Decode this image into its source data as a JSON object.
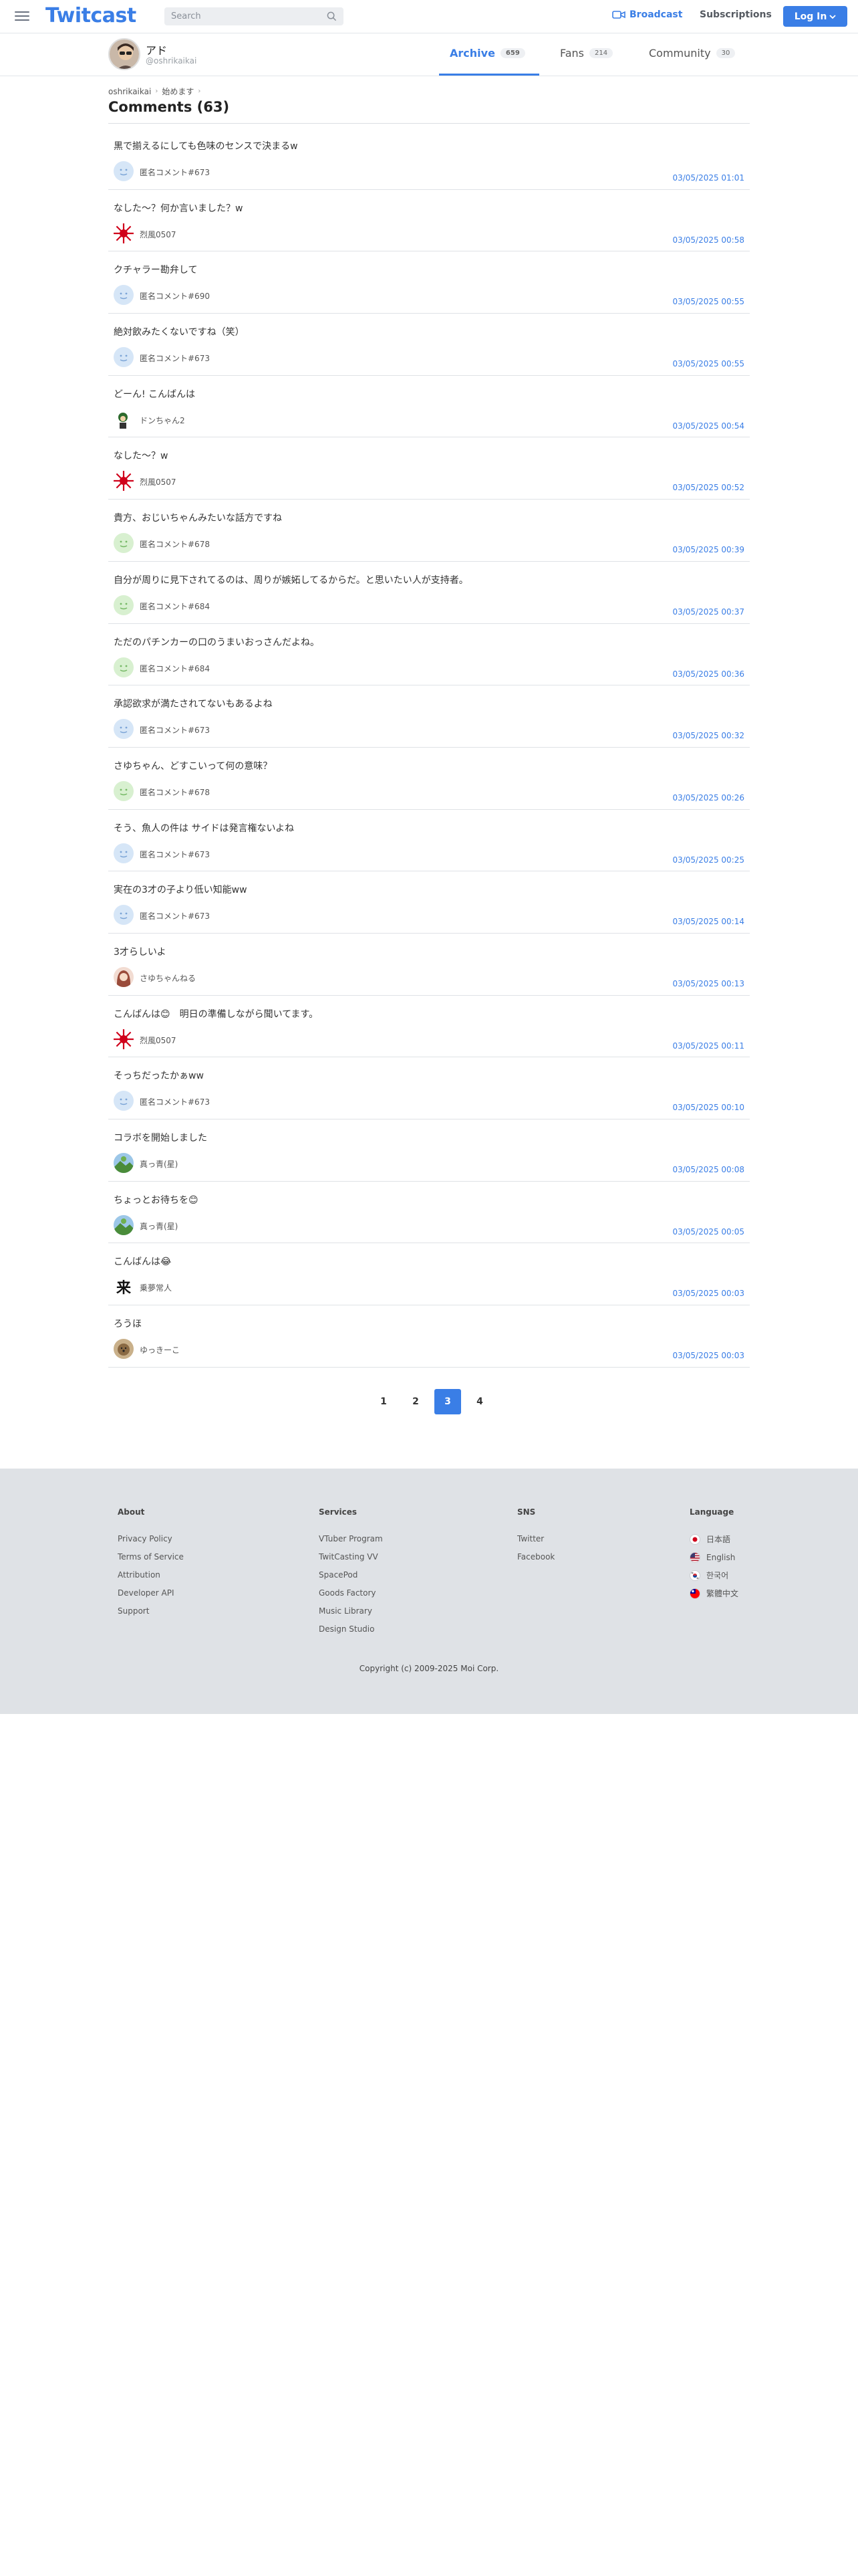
{
  "header": {
    "logo": "Twitcast",
    "search_placeholder": "Search",
    "broadcast_label": "Broadcast",
    "subscriptions_label": "Subscriptions",
    "login_label": "Log In",
    "accent": "#3a7ee6"
  },
  "profile": {
    "name": "アド",
    "handle": "@oshrikaikai"
  },
  "tabs": [
    {
      "label": "Archive",
      "count": "659",
      "active": true
    },
    {
      "label": "Fans",
      "count": "214",
      "active": false
    },
    {
      "label": "Community",
      "count": "30",
      "active": false
    }
  ],
  "breadcrumb": {
    "user": "oshrikaikai",
    "item": "始めます"
  },
  "page_title": "Comments (63)",
  "comments": [
    {
      "text": "黒で揃えるにしても色味のセンスで決まるw",
      "user": "匿名コメント#673",
      "date": "03/05/2025 01:01",
      "avatar": "anon-blue"
    },
    {
      "text": "なした〜？何か言いました？w",
      "user": "烈風0507",
      "date": "03/05/2025 00:58",
      "avatar": "red-sun"
    },
    {
      "text": "クチャラー勘弁して",
      "user": "匿名コメント#690",
      "date": "03/05/2025 00:55",
      "avatar": "anon-blue"
    },
    {
      "text": "絶対飲みたくないですね（笑）",
      "user": "匿名コメント#673",
      "date": "03/05/2025 00:55",
      "avatar": "anon-blue"
    },
    {
      "text": "どーん! こんばんは",
      "user": "ドンちゃん2",
      "date": "03/05/2025 00:54",
      "avatar": "character"
    },
    {
      "text": "なした〜？w",
      "user": "烈風0507",
      "date": "03/05/2025 00:52",
      "avatar": "red-sun"
    },
    {
      "text": "貴方、おじいちゃんみたいな話方ですね",
      "user": "匿名コメント#678",
      "date": "03/05/2025 00:39",
      "avatar": "anon-green"
    },
    {
      "text": "自分が周りに見下されてるのは、周りが嫉妬してるからだ。と思いたい人が支持者。",
      "user": "匿名コメント#684",
      "date": "03/05/2025 00:37",
      "avatar": "anon-green"
    },
    {
      "text": "ただのパチンカーの口のうまいおっさんだよね。",
      "user": "匿名コメント#684",
      "date": "03/05/2025 00:36",
      "avatar": "anon-green"
    },
    {
      "text": "承認欲求が満たされてないもあるよね",
      "user": "匿名コメント#673",
      "date": "03/05/2025 00:32",
      "avatar": "anon-blue"
    },
    {
      "text": "さゆちゃん、どすこいって何の意味？",
      "user": "匿名コメント#678",
      "date": "03/05/2025 00:26",
      "avatar": "anon-green"
    },
    {
      "text": "そう、魚人の件は サイドは発言権ないよね",
      "user": "匿名コメント#673",
      "date": "03/05/2025 00:25",
      "avatar": "anon-blue"
    },
    {
      "text": "実在の3才の子より低い知能ww",
      "user": "匿名コメント#673",
      "date": "03/05/2025 00:14",
      "avatar": "anon-blue"
    },
    {
      "text": "3才らしいよ",
      "user": "さゆちゃんねる",
      "date": "03/05/2025 00:13",
      "avatar": "girl"
    },
    {
      "text": "こんばんは😊　明日の準備しながら聞いてます。",
      "user": "烈風0507",
      "date": "03/05/2025 00:11",
      "avatar": "red-sun"
    },
    {
      "text": "そっちだったかぁww",
      "user": "匿名コメント#673",
      "date": "03/05/2025 00:10",
      "avatar": "anon-blue"
    },
    {
      "text": "コラボを開始しました",
      "user": "真っ青(星)",
      "date": "03/05/2025 00:08",
      "avatar": "landscape"
    },
    {
      "text": "ちょっとお待ちを😊",
      "user": "真っ青(星)",
      "date": "03/05/2025 00:05",
      "avatar": "landscape"
    },
    {
      "text": "こんばんは😂",
      "user": "乗夢常人",
      "date": "03/05/2025 00:03",
      "avatar": "kanji"
    },
    {
      "text": "ろうほ",
      "user": "ゆっきーこ",
      "date": "03/05/2025 00:03",
      "avatar": "dog"
    }
  ],
  "pagination": {
    "pages": [
      "1",
      "2",
      "3",
      "4"
    ],
    "current": "3"
  },
  "footer": {
    "about": {
      "title": "About",
      "links": [
        "Privacy Policy",
        "Terms of Service",
        "Attribution",
        "Developer API",
        "Support"
      ]
    },
    "services": {
      "title": "Services",
      "links": [
        "VTuber Program",
        "TwitCasting VV",
        "SpacePod",
        "Goods Factory",
        "Music Library",
        "Design Studio"
      ]
    },
    "sns": {
      "title": "SNS",
      "links": [
        "Twitter",
        "Facebook"
      ]
    },
    "language": {
      "title": "Language",
      "items": [
        {
          "label": "日本語",
          "flag": "japan-flag-icon"
        },
        {
          "label": "English",
          "flag": "us-flag-icon"
        },
        {
          "label": "한국어",
          "flag": "korea-flag-icon"
        },
        {
          "label": "繁體中文",
          "flag": "taiwan-flag-icon"
        }
      ]
    },
    "copyright": "Copyright (c) 2009-2025 Moi Corp."
  }
}
